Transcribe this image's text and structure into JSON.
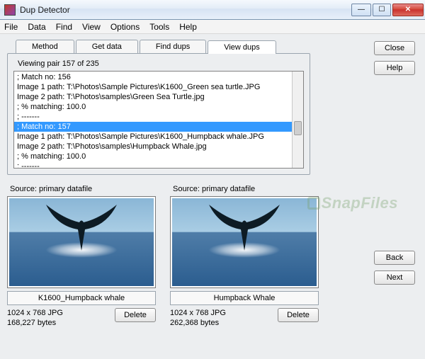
{
  "window": {
    "title": "Dup Detector",
    "min_glyph": "—",
    "max_glyph": "☐",
    "close_glyph": "✕"
  },
  "menu": [
    "File",
    "Data",
    "Find",
    "View",
    "Options",
    "Tools",
    "Help"
  ],
  "tabs": [
    {
      "label": "Method",
      "active": false
    },
    {
      "label": "Get data",
      "active": false
    },
    {
      "label": "Find dups",
      "active": false
    },
    {
      "label": "View dups",
      "active": true
    }
  ],
  "status": "Viewing pair 157 of 235",
  "list_lines": [
    {
      "text": "; Match no: 156",
      "sel": false
    },
    {
      "text": "Image 1 path: T:\\Photos\\Sample Pictures\\K1600_Green sea turtle.JPG",
      "sel": false
    },
    {
      "text": "Image 2 path: T:\\Photos\\samples\\Green Sea Turtle.jpg",
      "sel": false
    },
    {
      "text": "; % matching: 100.0",
      "sel": false
    },
    {
      "text": "; -------",
      "sel": false
    },
    {
      "text": "; Match no: 157",
      "sel": true
    },
    {
      "text": "Image 1 path: T:\\Photos\\Sample Pictures\\K1600_Humpback whale.JPG",
      "sel": false
    },
    {
      "text": "Image 2 path: T:\\Photos\\samples\\Humpback Whale.jpg",
      "sel": false
    },
    {
      "text": "; % matching: 100.0",
      "sel": false
    },
    {
      "text": "; -------",
      "sel": false
    }
  ],
  "right_buttons": {
    "close": "Close",
    "help": "Help"
  },
  "nav_buttons": {
    "back": "Back",
    "next": "Next"
  },
  "preview": {
    "left": {
      "source": "Source: primary datafile",
      "filename": "K1600_Humpback whale",
      "dims": "1024 x 768 JPG",
      "size": "168,227 bytes",
      "delete": "Delete"
    },
    "right": {
      "source": "Source: primary datafile",
      "filename": "Humpback Whale",
      "dims": "1024 x 768 JPG",
      "size": "262,368 bytes",
      "delete": "Delete"
    }
  },
  "watermark": "SnapFiles"
}
